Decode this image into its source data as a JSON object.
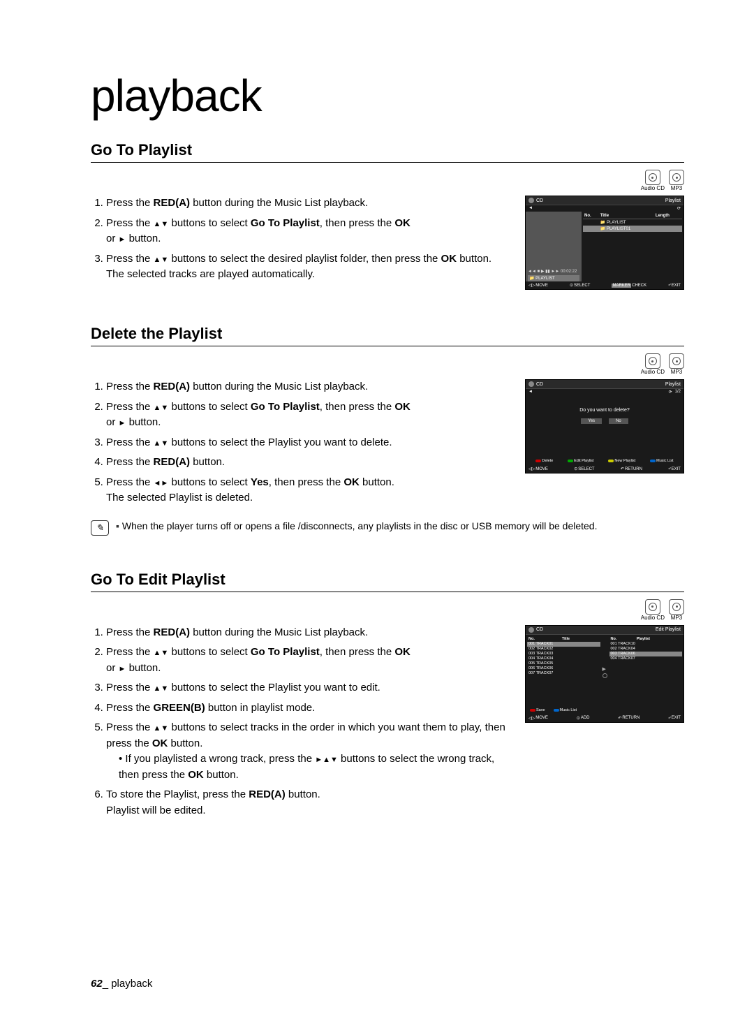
{
  "chapter": "playback",
  "disc_labels": {
    "audio_cd": "Audio CD",
    "mp3": "MP3"
  },
  "section1": {
    "title": "Go To Playlist",
    "steps": {
      "s1_a": "Press the ",
      "s1_b": "RED(A)",
      "s1_c": " button during the Music List playback.",
      "s2_a": "Press the ",
      "s2_b": " buttons to select ",
      "s2_c": "Go To Playlist",
      "s2_d": ", then press the ",
      "s2_e": "OK",
      "s2_f": "or ",
      "s2_g": " button.",
      "s3_a": "Press the ",
      "s3_b": " buttons to select the desired playlist folder, then press the ",
      "s3_c": "OK",
      "s3_d": " button.",
      "s3_sub": "The selected tracks are played automatically."
    },
    "screenshot": {
      "top_left": "CD",
      "top_right": "Playlist",
      "cols": {
        "no": "No.",
        "title": "Title",
        "length": "Length"
      },
      "rows": {
        "r1": "PLAYLIST",
        "r2": "PLAYLIST01"
      },
      "controls_time": "00:02:22",
      "left_tag": "PLAYLIST",
      "footer": {
        "move": "MOVE",
        "select": "SELECT",
        "check": "CHECK",
        "check_prefix": "MARKER",
        "exit": "EXIT"
      }
    }
  },
  "section2": {
    "title": "Delete the Playlist",
    "steps": {
      "s1_a": "Press the ",
      "s1_b": "RED(A)",
      "s1_c": " button during the Music List playback.",
      "s2_a": "Press the ",
      "s2_b": " buttons to select ",
      "s2_c": "Go To Playlist",
      "s2_d": ", then press the ",
      "s2_e": "OK",
      "s2_f": "or ",
      "s2_g": " button.",
      "s3_a": "Press the ",
      "s3_b": " buttons to select the Playlist you want to delete.",
      "s4_a": "Press the ",
      "s4_b": "RED(A)",
      "s4_c": " button.",
      "s5_a": "Press the ",
      "s5_b": " buttons to select ",
      "s5_c": "Yes",
      "s5_d": ", then press the ",
      "s5_e": "OK",
      "s5_f": " button.",
      "s5_sub": "The selected Playlist is deleted."
    },
    "screenshot": {
      "top_left": "CD",
      "top_right": "Playlist",
      "page": "1/2",
      "question": "Do you want to delete?",
      "yes": "Yes",
      "no": "No",
      "actions": {
        "a1": "Delete",
        "a2": "Edit Playlist",
        "a3": "New Playlist",
        "a4": "Music List"
      },
      "footer": {
        "move": "MOVE",
        "select": "SELECT",
        "return": "RETURN",
        "exit": "EXIT"
      }
    },
    "note": "When the player turns off or opens a file /disconnects, any playlists in the disc or USB memory will be deleted."
  },
  "section3": {
    "title": "Go To Edit Playlist",
    "steps": {
      "s1_a": "Press the ",
      "s1_b": "RED(A)",
      "s1_c": " button during the Music List playback.",
      "s2_a": "Press the ",
      "s2_b": " buttons to select ",
      "s2_c": "Go To Playlist",
      "s2_d": ", then press the ",
      "s2_e": "OK",
      "s2_f": "or ",
      "s2_g": " button.",
      "s3_a": "Press the ",
      "s3_b": " buttons to select the Playlist you want to edit.",
      "s4_a": "Press the ",
      "s4_b": "GREEN(B)",
      "s4_c": " button in playlist mode.",
      "s5_a": "Press the ",
      "s5_b": " buttons to select tracks in the order in which you want them to play, then press the ",
      "s5_c": "OK",
      "s5_d": " button.",
      "s5_sub_a": "If you playlisted a wrong track, press the ",
      "s5_sub_b": " buttons to select the wrong track, then press the ",
      "s5_sub_c": "OK",
      "s5_sub_d": " button.",
      "s6_a": "To store the Playlist, press the ",
      "s6_b": "RED(A)",
      "s6_c": " button.",
      "s6_sub": "Playlist will be edited."
    },
    "screenshot": {
      "top_left": "CD",
      "top_right": "Edit Playlist",
      "left_cols": {
        "no": "No.",
        "title": "Title"
      },
      "right_cols": {
        "no": "No.",
        "playlist": "Playlist"
      },
      "left_tracks": [
        "001  TRACK01",
        "002  TRACK02",
        "003  TRACK03",
        "004  TRACK04",
        "005  TRACK05",
        "006  TRACK06",
        "007  TRACK07"
      ],
      "right_tracks": [
        "001  TRACK10",
        "002  TRACK04",
        "003  TRACK06",
        "004  TRACK07"
      ],
      "actions": {
        "a1": "Save",
        "a2": "Music List"
      },
      "footer": {
        "move": "MOVE",
        "add": "ADD",
        "return": "RETURN",
        "exit": "EXIT"
      }
    }
  },
  "footer": {
    "page_num": "62",
    "sep": "_ ",
    "label": "playback"
  }
}
